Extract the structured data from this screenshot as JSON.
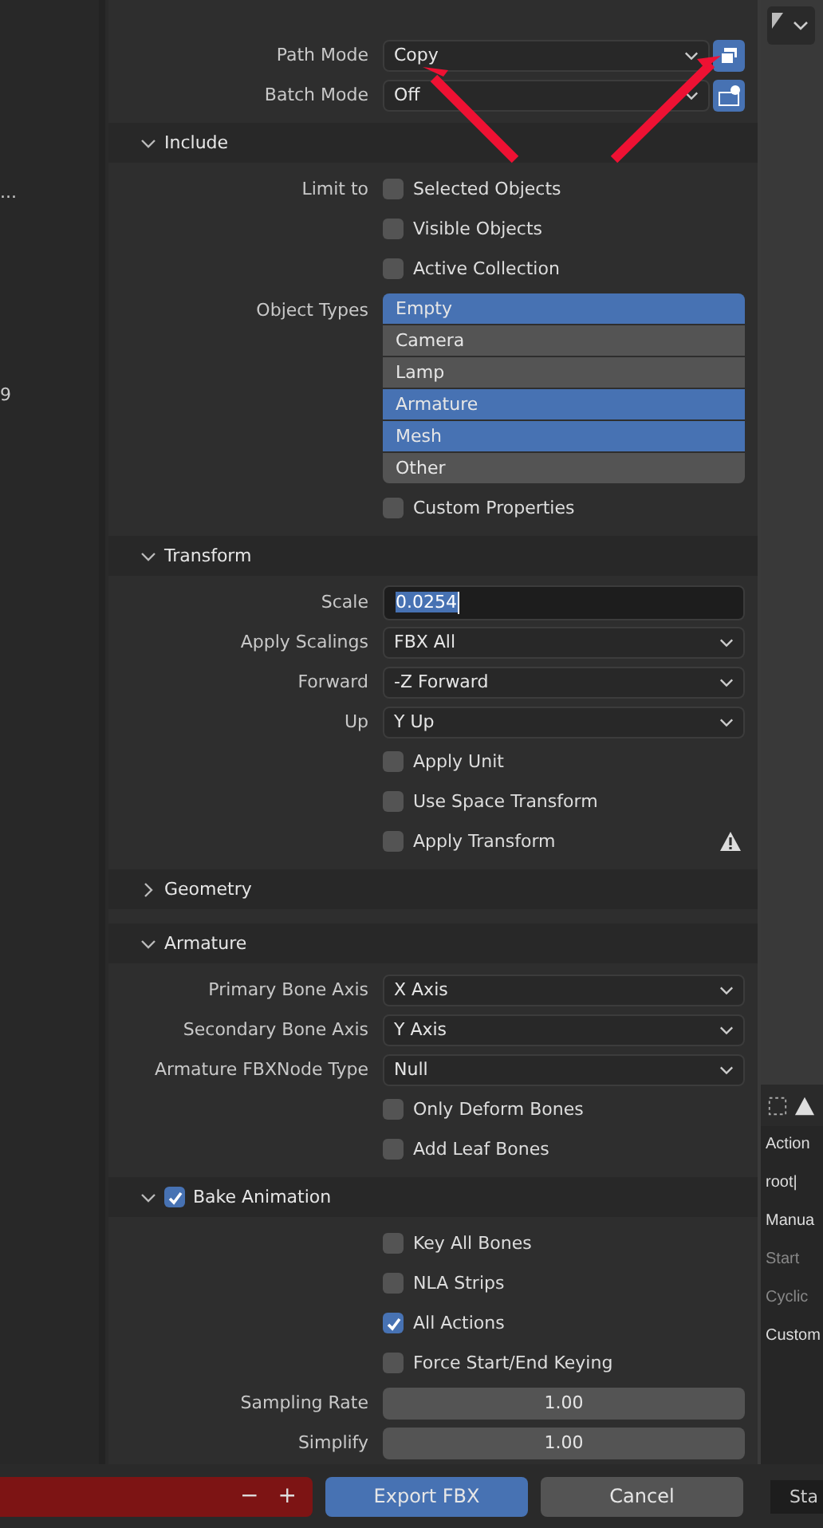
{
  "left_strip": {
    "texts": [
      "...",
      "9"
    ]
  },
  "top_rows": [
    {
      "label": "Path Mode",
      "kind": "dropdown",
      "value": "Copy"
    },
    {
      "label": "Batch Mode",
      "kind": "dropdown",
      "value": "Off"
    }
  ],
  "sections": [
    {
      "title": "Include",
      "expanded": true,
      "rows": [
        {
          "kind": "checkbox",
          "label": "Limit to",
          "text": "Selected Objects",
          "checked": false
        },
        {
          "kind": "checkbox",
          "text": "Visible Objects",
          "checked": false
        },
        {
          "kind": "checkbox",
          "text": "Active Collection",
          "checked": false
        },
        {
          "kind": "list",
          "label": "Object Types",
          "items": [
            {
              "text": "Empty",
              "selected": true
            },
            {
              "text": "Camera",
              "selected": false
            },
            {
              "text": "Lamp",
              "selected": false
            },
            {
              "text": "Armature",
              "selected": true
            },
            {
              "text": "Mesh",
              "selected": true
            },
            {
              "text": "Other",
              "selected": false
            }
          ]
        },
        {
          "kind": "checkbox",
          "text": "Custom Properties",
          "checked": false
        }
      ]
    },
    {
      "title": "Transform",
      "expanded": true,
      "rows": [
        {
          "kind": "text",
          "label": "Scale",
          "value": "0.0254",
          "text_selected": true
        },
        {
          "kind": "dropdown",
          "label": "Apply Scalings",
          "value": "FBX All"
        },
        {
          "kind": "dropdown",
          "label": "Forward",
          "value": "-Z Forward"
        },
        {
          "kind": "dropdown",
          "label": "Up",
          "value": "Y Up"
        },
        {
          "kind": "checkbox",
          "text": "Apply Unit",
          "checked": false
        },
        {
          "kind": "checkbox",
          "text": "Use Space Transform",
          "checked": false
        },
        {
          "kind": "checkbox",
          "text": "Apply Transform",
          "checked": false,
          "warning": true
        }
      ]
    },
    {
      "title": "Geometry",
      "expanded": false
    },
    {
      "title": "Armature",
      "expanded": true,
      "rows": [
        {
          "kind": "dropdown",
          "label": "Primary Bone Axis",
          "value": "X Axis"
        },
        {
          "kind": "dropdown",
          "label": "Secondary Bone Axis",
          "value": "Y Axis"
        },
        {
          "kind": "dropdown",
          "label": "Armature FBXNode Type",
          "value": "Null"
        },
        {
          "kind": "checkbox",
          "text": "Only Deform Bones",
          "checked": false
        },
        {
          "kind": "checkbox",
          "text": "Add Leaf Bones",
          "checked": false
        }
      ]
    },
    {
      "title": "Bake Animation",
      "expanded": true,
      "checked": true,
      "rows": [
        {
          "kind": "checkbox",
          "text": "Key All Bones",
          "checked": false
        },
        {
          "kind": "checkbox",
          "text": "NLA Strips",
          "checked": false
        },
        {
          "kind": "checkbox",
          "text": "All Actions",
          "checked": true
        },
        {
          "kind": "checkbox",
          "text": "Force Start/End Keying",
          "checked": false
        },
        {
          "kind": "number",
          "label": "Sampling Rate",
          "value": "1.00"
        },
        {
          "kind": "number",
          "label": "Simplify",
          "value": "1.00"
        }
      ]
    }
  ],
  "right_strip": {
    "texts": [
      "Action",
      "root|",
      "Manua",
      "Start",
      "Cyclic",
      "Custom"
    ]
  },
  "footer": {
    "minus": "−",
    "plus": "+",
    "buttons": [
      "Export FBX",
      "Cancel"
    ],
    "right_text": "Sta"
  }
}
